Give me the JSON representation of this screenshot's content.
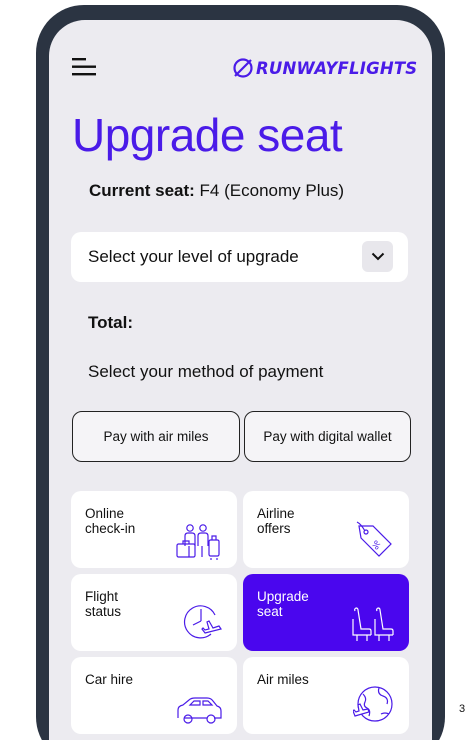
{
  "header": {
    "logo_text": "RUNWAYFLIGHTS"
  },
  "page": {
    "title": "Upgrade seat"
  },
  "current_seat": {
    "label": "Current seat:",
    "value": "F4 (Economy Plus)"
  },
  "upgrade_select": {
    "placeholder": "Select your level of upgrade"
  },
  "total": {
    "label": "Total:"
  },
  "payment": {
    "heading": "Select your method of payment",
    "air_miles_label": "Pay with air miles",
    "digital_wallet_label": "Pay with digital wallet"
  },
  "tiles": [
    {
      "label": "Online\ncheck-in",
      "icon": "check-in-icon"
    },
    {
      "label": "Airline\noffers",
      "icon": "offer-tag-icon"
    },
    {
      "label": "Flight\nstatus",
      "icon": "flight-status-icon"
    },
    {
      "label": "Upgrade\nseat",
      "icon": "seats-icon",
      "active": true
    },
    {
      "label": "Car hire",
      "icon": "car-icon"
    },
    {
      "label": "Air miles",
      "icon": "globe-plane-icon"
    }
  ],
  "page_number": "3",
  "colors": {
    "accent": "#4a1be8",
    "active_tile": "#4a06ee",
    "phone_frame": "#2b3442",
    "screen_bg": "#ecebf0"
  }
}
